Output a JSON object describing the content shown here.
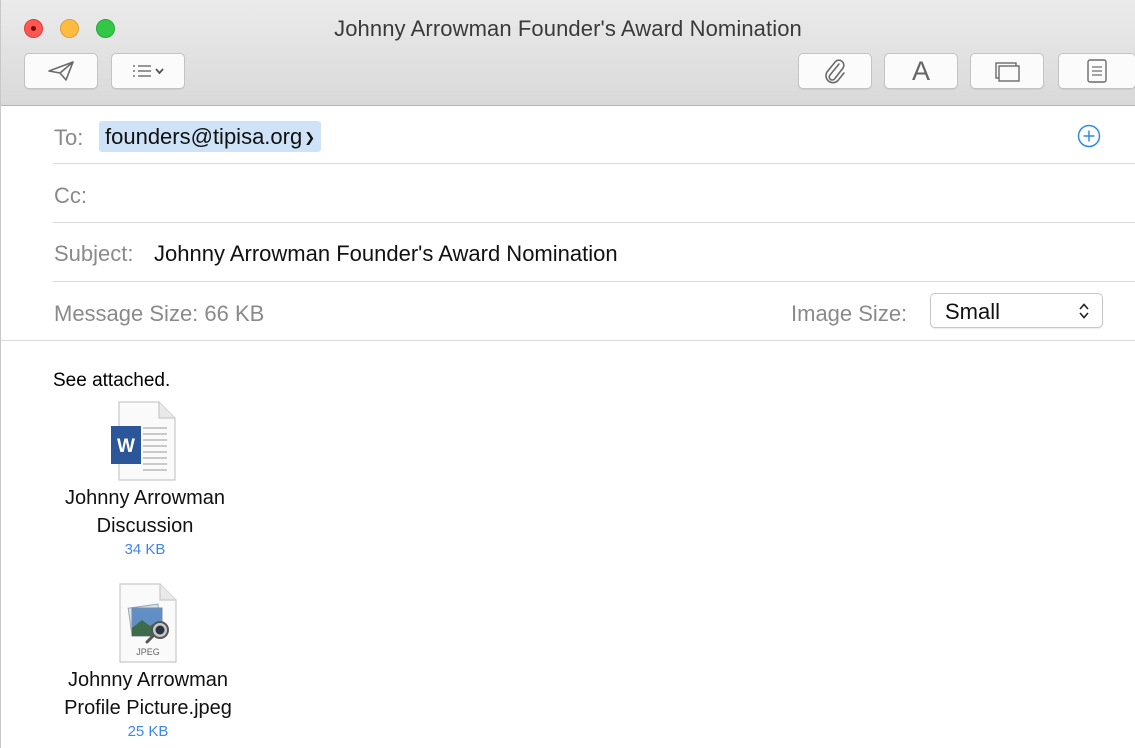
{
  "window": {
    "title": "Johnny Arrowman Founder's Award Nomination"
  },
  "toolbar": {
    "send": "paper-plane-icon",
    "header_fields": "list-icon",
    "attach": "paperclip-icon",
    "format_label": "A",
    "photo_browser": "photo-browser-icon",
    "stationery": "stationery-icon"
  },
  "compose": {
    "to_label": "To:",
    "to_recipient": "founders@tipisa.org",
    "cc_label": "Cc:",
    "subject_label": "Subject:",
    "subject_value": "Johnny Arrowman Founder's Award Nomination",
    "message_size_label": "Message Size: 66 KB",
    "image_size_label": "Image Size:",
    "image_size_value": "Small"
  },
  "body": {
    "text": "See attached.",
    "attachments": [
      {
        "name_line1": "Johnny Arrowman",
        "name_line2": "Discussion",
        "size": "34 KB",
        "icon": "word-document-icon",
        "icon_letter": "W"
      },
      {
        "name_line1": "Johnny Arrowman",
        "name_line2": "Profile Picture.jpeg",
        "size": "25 KB",
        "icon": "jpeg-file-icon",
        "icon_label": "JPEG"
      }
    ]
  },
  "colors": {
    "accent": "#3f86e6",
    "token_bg": "#cfe3f8",
    "close": "#fc5753",
    "minimize": "#fdbc40",
    "zoom": "#33c748"
  }
}
